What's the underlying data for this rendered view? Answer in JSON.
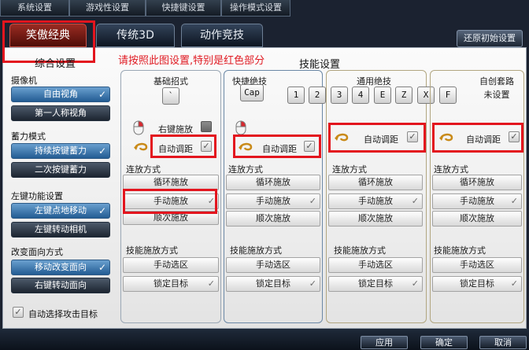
{
  "top_tabs": [
    "系统设置",
    "游戏性设置",
    "快捷键设置",
    "操作模式设置"
  ],
  "mode_tabs": [
    "笑傲经典",
    "传统3D",
    "动作竞技"
  ],
  "restore_label": "还原初始设置",
  "annotation_note": "请按照此图设置,特别是红色部分",
  "left": {
    "title": "综合设置",
    "camera_label": "摄像机",
    "camera_free": "自由视角",
    "camera_first": "第一人称视角",
    "charge_label": "蓄力模式",
    "charge_hold": "持续按键蓄力",
    "charge_twice": "二次按键蓄力",
    "leftkey_label": "左键功能设置",
    "leftkey_move": "左键点地移动",
    "leftkey_camera": "左键转动相机",
    "facing_label": "改变面向方式",
    "facing_move": "移动改变面向",
    "facing_right": "右键转动面向",
    "auto_target": "自动选择攻击目标"
  },
  "skills_title": "技能设置",
  "basic": {
    "title": "基础招式",
    "key": "`",
    "right_cast": "右键施放",
    "auto_range": "自动调距",
    "combo_label": "连放方式",
    "combo_loop": "循环施放",
    "combo_manual": "手动施放",
    "combo_order": "顺次施放",
    "cast_label": "技能施放方式",
    "cast_manual": "手动选区",
    "cast_lock": "锁定目标"
  },
  "quick": {
    "title": "快捷绝技",
    "key": "Cap",
    "auto_range": "自动调距",
    "combo_label": "连放方式",
    "combo_loop": "循环施放",
    "combo_manual": "手动施放",
    "combo_order": "顺次施放",
    "cast_label": "技能施放方式",
    "cast_manual": "手动选区",
    "cast_lock": "锁定目标"
  },
  "general": {
    "title": "通用绝技",
    "keys": [
      "1",
      "2",
      "3",
      "4",
      "E",
      "Z",
      "X",
      "F"
    ],
    "auto_range": "自动调距",
    "combo_label": "连放方式",
    "combo_loop": "循环施放",
    "combo_manual": "手动施放",
    "combo_order": "顺次施放",
    "cast_label": "技能施放方式",
    "cast_manual": "手动选区",
    "cast_lock": "锁定目标"
  },
  "custom": {
    "title": "自创套路",
    "status": "未设置",
    "auto_range": "自动调距",
    "combo_label": "连放方式",
    "combo_loop": "循环施放",
    "combo_manual": "手动施放",
    "combo_order": "顺次施放",
    "cast_label": "技能施放方式",
    "cast_manual": "手动选区",
    "cast_lock": "锁定目标"
  },
  "bottom": {
    "apply": "应用",
    "ok": "确定",
    "cancel": "取消"
  },
  "colors": {
    "highlight_red": "#e3151e",
    "annotation_red": "#e01b23",
    "selected_blue": "#235c93"
  }
}
